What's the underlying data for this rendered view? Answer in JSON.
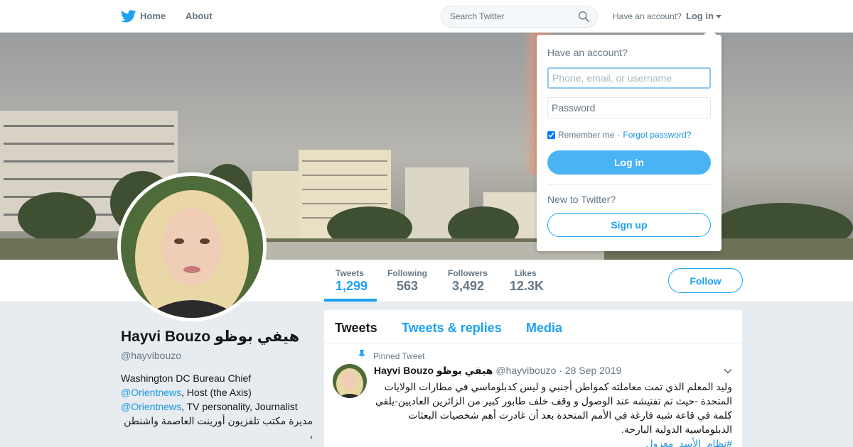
{
  "nav": {
    "home_label": "Home",
    "about_label": "About",
    "search_placeholder": "Search Twitter",
    "have_account": "Have an account?",
    "login_label": "Log in"
  },
  "profile": {
    "name": "Hayvi Bouzo هيفي بوظو",
    "handle": "@hayvibouzo",
    "bio_line1": "Washington DC Bureau Chief",
    "bio_link1": "@Orientnews",
    "bio_text2": ", Host (the Axis)",
    "bio_link2": "@Orientnews",
    "bio_text3": ", TV personality, Journalist",
    "bio_arabic": "مديرة مكتب تلفزيون أورينت العاصمة واشنطن ،"
  },
  "stats": [
    {
      "label": "Tweets",
      "value": "1,299"
    },
    {
      "label": "Following",
      "value": "563"
    },
    {
      "label": "Followers",
      "value": "3,492"
    },
    {
      "label": "Likes",
      "value": "12.3K"
    }
  ],
  "follow_label": "Follow",
  "timeline": {
    "tabs": [
      "Tweets",
      "Tweets & replies",
      "Media"
    ],
    "pinned_label": "Pinned Tweet",
    "tweet": {
      "name": "Hayvi Bouzo هيفي بوظو",
      "handle": "@hayvibouzo",
      "separator": " · ",
      "date": "28 Sep 2019",
      "text": "وليد المعلم الذي تمت معاملته كمواطن أجنبي و ليس كدبلوماسي في مطارات الولايات المتحدة -حيث تم تفتيشه عند الوصول و وقف خلف طابور كبير من الزائرين العاديين-يلقي كلمة في قاعة شبه فارغة في الأمم المتحدة بعد أن غادرت أهم شخصيات البعثات الدبلوماسية الدولية البارحة.",
      "hashtag": "#نظام_الأسد_معزول"
    }
  },
  "login_dropdown": {
    "title": "Have an account?",
    "username_placeholder": "Phone, email, or username",
    "password_placeholder": "Password",
    "remember_label": "Remember me",
    "separator": " · ",
    "forgot_label": "Forgot password?",
    "login_button": "Log in",
    "new_label": "New to Twitter?",
    "signup_button": "Sign up"
  },
  "colors": {
    "accent": "#1da1f2",
    "login_button_bg": "#4ab3f4",
    "page_bg": "#e6ecf0"
  }
}
